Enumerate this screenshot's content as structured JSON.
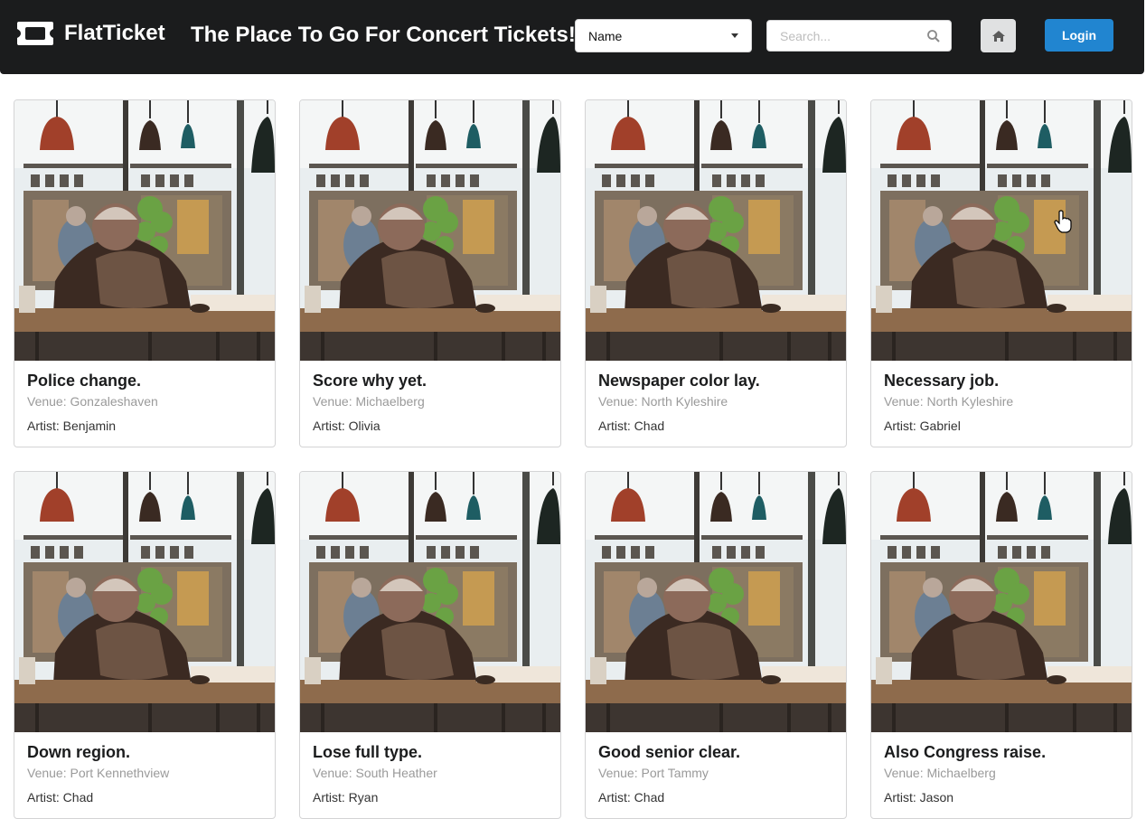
{
  "header": {
    "brand": "FlatTicket",
    "brand_icon": "ticket-icon",
    "tagline": "The Place To Go For Concert Tickets!",
    "sort_select": {
      "value": "Name"
    },
    "search": {
      "placeholder": "Search...",
      "value": "",
      "icon": "search-icon"
    },
    "home_icon": "home-icon",
    "login_label": "Login"
  },
  "colors": {
    "topbar": "#1b1c1d",
    "login_button": "#2185d0",
    "home_button": "#e0e1e2",
    "venue_text": "#9a9a9a"
  },
  "concerts": [
    {
      "title": "Police change.",
      "venue": "Venue: Gonzaleshaven",
      "artist": "Artist: Benjamin"
    },
    {
      "title": "Score why yet.",
      "venue": "Venue: Michaelberg",
      "artist": "Artist: Olivia"
    },
    {
      "title": "Newspaper color lay.",
      "venue": "Venue: North Kyleshire",
      "artist": "Artist: Chad"
    },
    {
      "title": "Necessary job.",
      "venue": "Venue: North Kyleshire",
      "artist": "Artist: Gabriel"
    },
    {
      "title": "Down region.",
      "venue": "Venue: Port Kennethview",
      "artist": "Artist: Chad"
    },
    {
      "title": "Lose full type.",
      "venue": "Venue: South Heather",
      "artist": "Artist: Ryan"
    },
    {
      "title": "Good senior clear.",
      "venue": "Venue: Port Tammy",
      "artist": "Artist: Chad"
    },
    {
      "title": "Also Congress raise.",
      "venue": "Venue: Michaelberg",
      "artist": "Artist: Jason"
    }
  ]
}
